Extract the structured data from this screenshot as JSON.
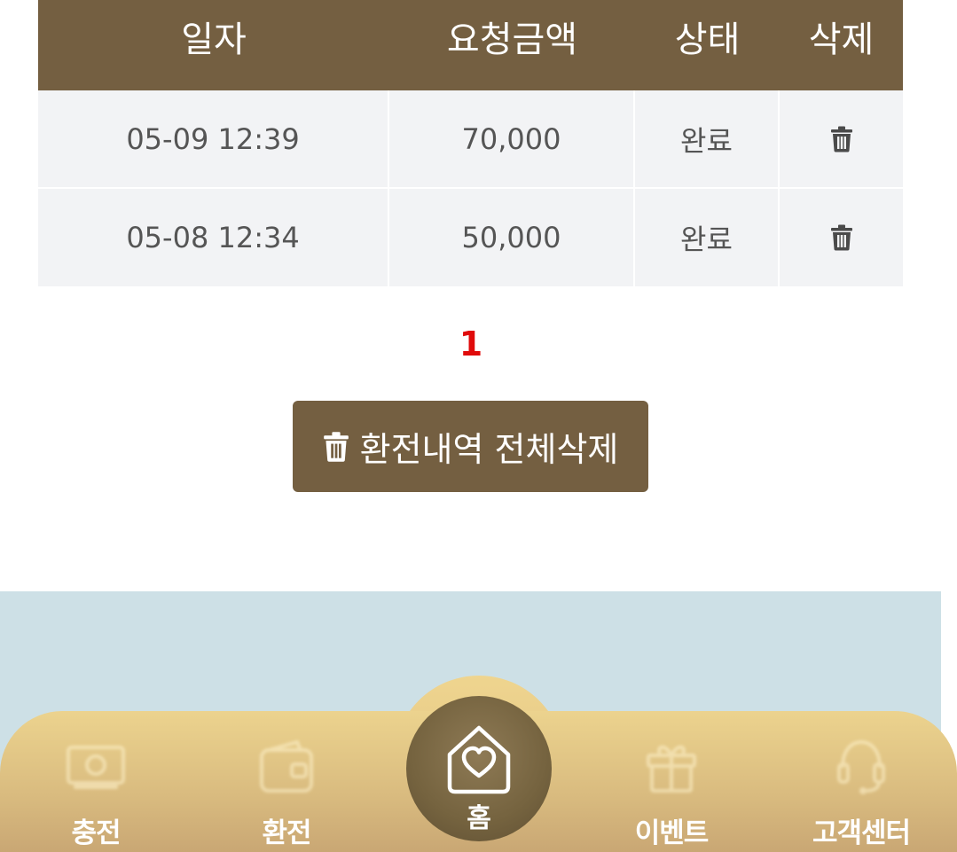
{
  "table": {
    "headers": {
      "date": "일자",
      "amount": "요청금액",
      "status": "상태",
      "delete": "삭제"
    },
    "rows": [
      {
        "date": "05-09 12:39",
        "amount": "70,000",
        "status": "완료",
        "delete_icon": "trash-icon"
      },
      {
        "date": "05-08 12:34",
        "amount": "50,000",
        "status": "완료",
        "delete_icon": "trash-icon"
      }
    ]
  },
  "pagination": {
    "current_page": "1"
  },
  "delete_all_button": {
    "label": "환전내역 전체삭제",
    "icon": "trash-icon"
  },
  "bottom_nav": {
    "items": [
      {
        "label": "충전",
        "icon": "money-icon"
      },
      {
        "label": "환전",
        "icon": "wallet-icon"
      },
      {
        "label": "홈",
        "icon": "home-heart-icon"
      },
      {
        "label": "이벤트",
        "icon": "gift-icon"
      },
      {
        "label": "고객센터",
        "icon": "headset-icon"
      }
    ]
  },
  "colors": {
    "header_bg": "#745f41",
    "row_bg": "#f2f3f5",
    "page_active": "#e00b0b",
    "footer_bg": "#cde0e6",
    "nav_gold": "#e6cc8a"
  }
}
